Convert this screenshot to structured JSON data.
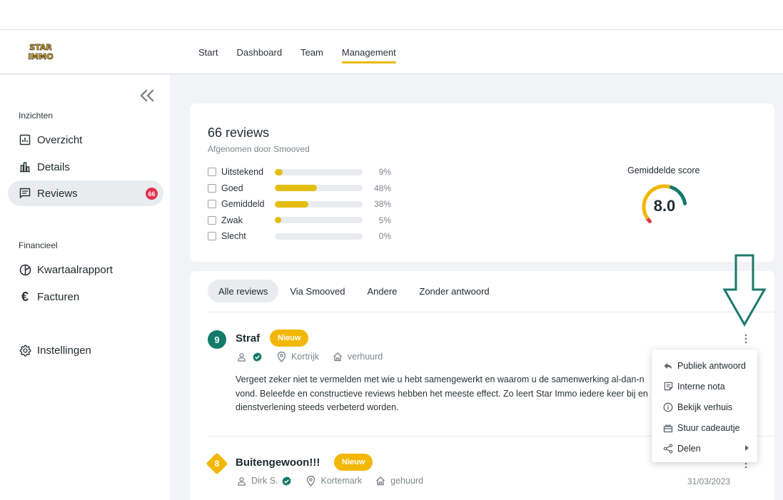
{
  "header": {
    "logo_text": [
      "STAR",
      "IMMO"
    ],
    "nav": [
      {
        "label": "Start",
        "active": false
      },
      {
        "label": "Dashboard",
        "active": false
      },
      {
        "label": "Team",
        "active": false
      },
      {
        "label": "Management",
        "active": true
      }
    ]
  },
  "sidebar": {
    "collapse_icon": "double-chevron-left-icon",
    "section_insights": "Inzichten",
    "section_financial": "Financieel",
    "items": [
      {
        "label": "Overzicht",
        "icon": "chart-box-icon"
      },
      {
        "label": "Details",
        "icon": "bar-chart-icon"
      },
      {
        "label": "Reviews",
        "icon": "message-icon",
        "badge": "66",
        "active": true
      },
      {
        "label": "Kwartaalrapport",
        "icon": "pie-chart-icon"
      },
      {
        "label": "Facturen",
        "icon": "euro-icon"
      },
      {
        "label": "Instellingen",
        "icon": "gear-icon"
      }
    ]
  },
  "summary": {
    "title": "66 reviews",
    "subtitle": "Afgenomen door Smooved",
    "distribution": [
      {
        "label": "Uitstekend",
        "percent": 9,
        "percent_label": "9%"
      },
      {
        "label": "Goed",
        "percent": 48,
        "percent_label": "48%"
      },
      {
        "label": "Gemiddeld",
        "percent": 38,
        "percent_label": "38%"
      },
      {
        "label": "Zwak",
        "percent": 5,
        "percent_label": "5%"
      },
      {
        "label": "Slecht",
        "percent": 0,
        "percent_label": "0%"
      }
    ],
    "average_label": "Gemiddelde score",
    "average_value": "8.0",
    "average_fraction": 0.8,
    "colors": {
      "bar": "#e3bd12",
      "gauge_low": "#e0314b",
      "gauge_mid": "#f2b705",
      "gauge_high": "#127a6a"
    }
  },
  "tabs": [
    {
      "label": "Alle reviews",
      "active": true
    },
    {
      "label": "Via Smooved",
      "active": false
    },
    {
      "label": "Andere",
      "active": false
    },
    {
      "label": "Zonder antwoord",
      "active": false
    }
  ],
  "reviews": [
    {
      "score": "9",
      "title": "Straf",
      "badge": "Nieuw",
      "author": "",
      "location": "Kortrijk",
      "status": "verhuurd",
      "text": "Vergeet zeker niet te vermelden met wie u hebt samengewerkt en waarom u de samenwerking al-dan-n vond. Beleefde en constructieve reviews hebben het meeste effect. Zo leert Star Immo iedere keer bij en dienstverlening steeds verbeterd worden."
    },
    {
      "score": "8",
      "title": "Buitengewoon!!!",
      "badge": "Nieuw",
      "author": "Dirk S.",
      "location": "Kortemark",
      "status": "gehuurd",
      "date": "31/03/2023"
    }
  ],
  "context_menu": [
    {
      "label": "Publiek antwoord",
      "icon": "reply-icon"
    },
    {
      "label": "Interne nota",
      "icon": "note-icon"
    },
    {
      "label": "Bekijk verhuis",
      "icon": "info-icon"
    },
    {
      "label": "Stuur cadeautje",
      "icon": "gift-icon"
    },
    {
      "label": "Delen",
      "icon": "share-icon",
      "submenu": true
    }
  ]
}
